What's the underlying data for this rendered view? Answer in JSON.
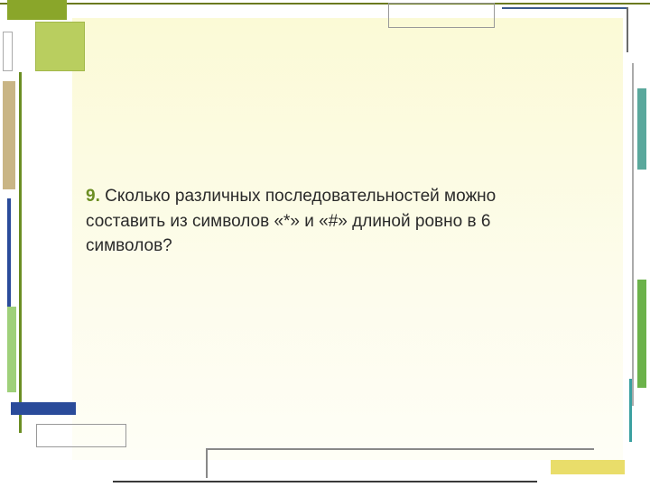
{
  "question": {
    "number": "9.",
    "text": "Сколько различных последовательностей можно составить из символов «*» и «#» длиной ровно в 6 символов?"
  }
}
